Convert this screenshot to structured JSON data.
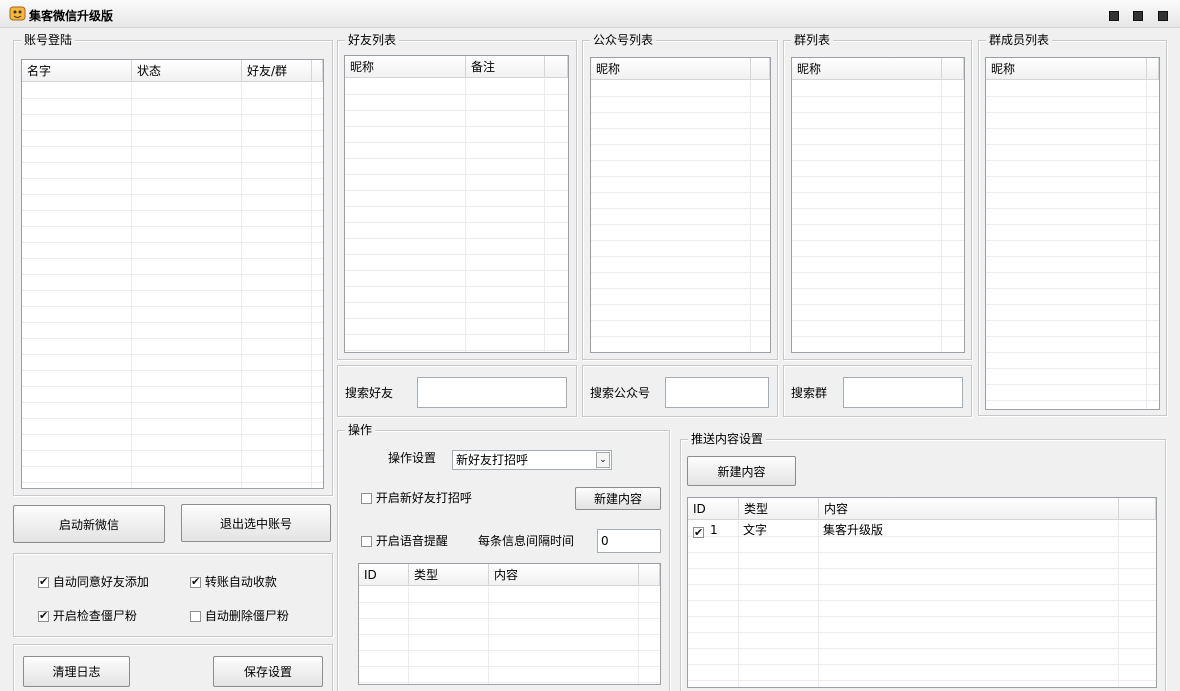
{
  "window": {
    "title": "集客微信升级版"
  },
  "account": {
    "legend": "账号登陆",
    "columns": [
      "名字",
      "状态",
      "好友/群"
    ],
    "start_button": "启动新微信",
    "logout_button": "退出选中账号"
  },
  "options": {
    "auto_accept_friend": {
      "label": "自动同意好友添加",
      "checked": true
    },
    "auto_receive_transfer": {
      "label": "转账自动收款",
      "checked": true
    },
    "check_zombie": {
      "label": "开启检查僵尸粉",
      "checked": true
    },
    "auto_delete_zombie": {
      "label": "自动删除僵尸粉",
      "checked": false
    }
  },
  "bottom_buttons": {
    "clear_log": "清理日志",
    "save_settings": "保存设置"
  },
  "friends": {
    "legend": "好友列表",
    "columns": [
      "昵称",
      "备注"
    ],
    "search_label": "搜索好友",
    "search_value": ""
  },
  "official": {
    "legend": "公众号列表",
    "columns": [
      "昵称"
    ],
    "search_label": "搜索公众号",
    "search_value": ""
  },
  "groups": {
    "legend": "群列表",
    "columns": [
      "昵称"
    ],
    "search_label": "搜索群",
    "search_value": ""
  },
  "members": {
    "legend": "群成员列表",
    "columns": [
      "昵称"
    ]
  },
  "operation": {
    "legend": "操作",
    "setting_label": "操作设置",
    "setting_value": "新好友打招呼",
    "greet_checkbox": {
      "label": "开启新好友打招呼",
      "checked": false
    },
    "new_content_button": "新建内容",
    "voice_checkbox": {
      "label": "开启语音提醒",
      "checked": false
    },
    "interval_label": "每条信息间隔时间",
    "interval_value": "0",
    "columns": [
      "ID",
      "类型",
      "内容"
    ]
  },
  "push": {
    "legend": "推送内容设置",
    "new_content_button": "新建内容",
    "columns": [
      "ID",
      "类型",
      "内容"
    ],
    "rows": [
      {
        "checked": true,
        "id": "1",
        "type": "文字",
        "content": "集客升级版"
      }
    ]
  }
}
